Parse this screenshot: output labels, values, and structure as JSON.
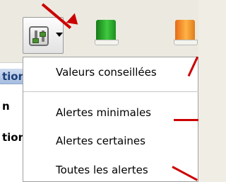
{
  "menu": {
    "items": [
      {
        "label": "Valeurs conseillées"
      },
      {
        "label": "Alertes minimales"
      },
      {
        "label": "Alertes certaines"
      },
      {
        "label": "Toutes les alertes"
      }
    ]
  },
  "left_panel": {
    "cells": [
      "tion",
      "n",
      "tion"
    ]
  },
  "colors": {
    "annotation": "#cc0000",
    "selection": "#c4d6f2",
    "menu_bg": "#ffffff"
  },
  "icons": [
    "alert-level-sliders-icon",
    "dropdown-arrow-icon",
    "green-book-icon",
    "orange-book-icon"
  ]
}
